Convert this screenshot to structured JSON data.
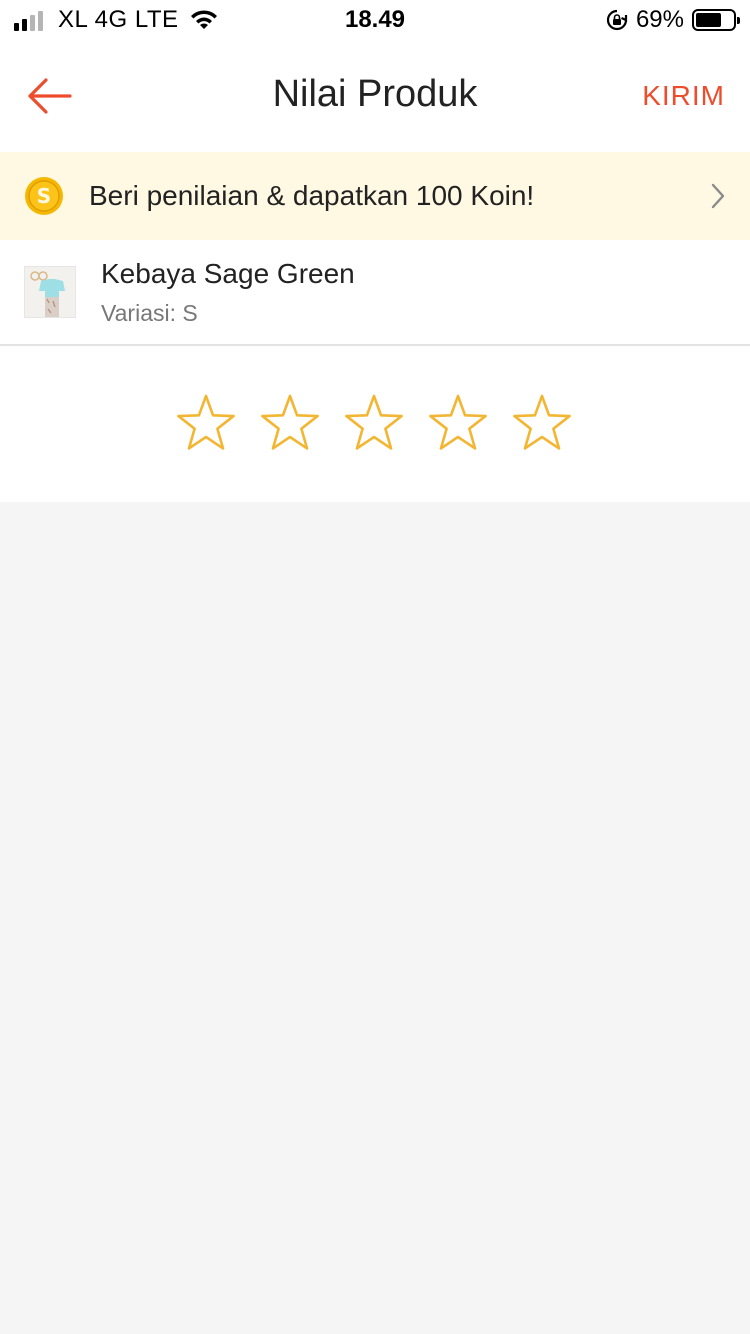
{
  "status_bar": {
    "carrier": "XL 4G LTE",
    "time": "18.49",
    "battery": "69%",
    "battery_level": 0.69
  },
  "header": {
    "title": "Nilai Produk",
    "submit_label": "KIRIM"
  },
  "banner": {
    "coin_letter": "S",
    "text": "Beri penilaian & dapatkan 100 Koin!"
  },
  "product": {
    "name": "Kebaya Sage Green",
    "variant": "Variasi: S"
  },
  "rating": {
    "max_stars": 5,
    "selected": 0
  },
  "colors": {
    "accent": "#ee4d2d",
    "star": "#f2b632",
    "banner_bg": "#fff8e3",
    "coin": "#f5b800"
  }
}
